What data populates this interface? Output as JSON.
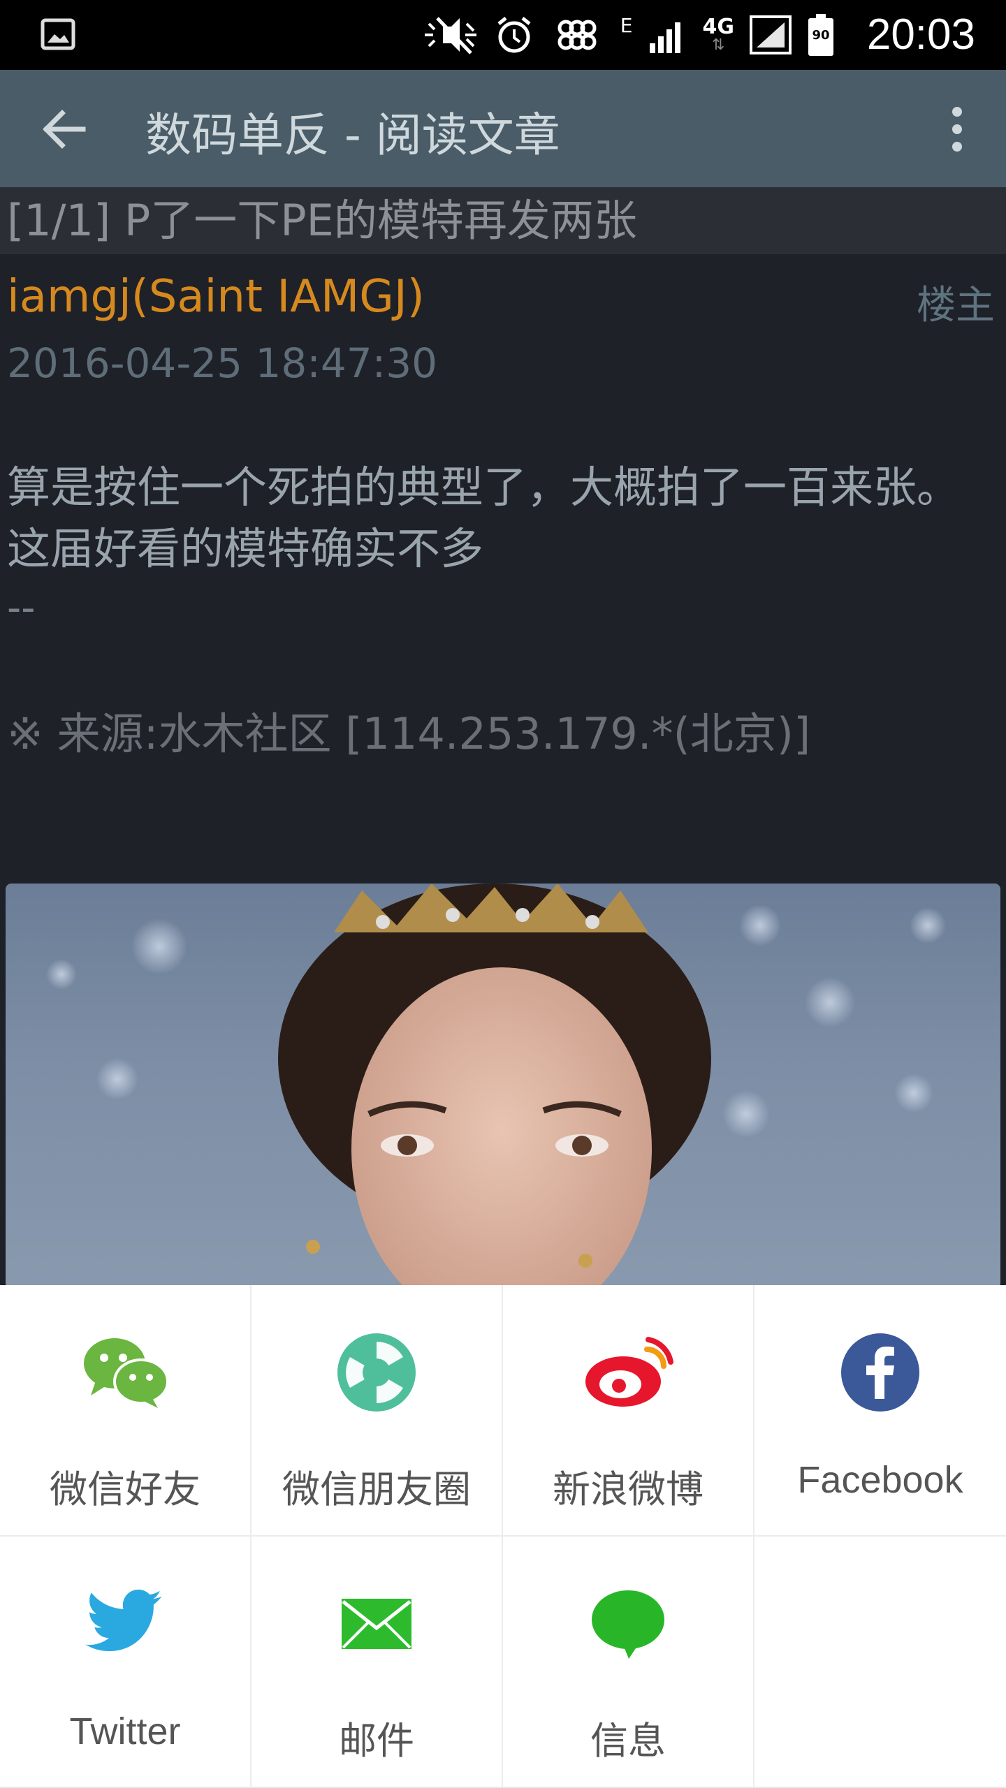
{
  "status_bar": {
    "time": "20:03",
    "battery": "90",
    "network_type": "4G",
    "edge_indicator": "E",
    "icons": [
      "gallery-icon",
      "mute-icon",
      "alarm-icon",
      "carrier-icon",
      "signal-icon",
      "battery-icon"
    ]
  },
  "app_bar": {
    "title": "数码单反 - 阅读文章"
  },
  "post": {
    "thread_title": "[1/1] P了一下PE的模特再发两张",
    "author": "iamgj(Saint IAMGJ)",
    "floor": "楼主",
    "time": "2016-04-25 18:47:30",
    "body": "算是按住一个死拍的典型了，大概拍了一百来张。这届好看的模特确实不多",
    "signature": "--",
    "source": "※ 来源:水木社区 [114.253.179.*(北京)]"
  },
  "share": {
    "items": [
      {
        "label": "微信好友",
        "icon": "wechat-icon",
        "color": "#6ab640"
      },
      {
        "label": "微信朋友圈",
        "icon": "wechat-moments-icon",
        "color": "#4fbf9b"
      },
      {
        "label": "新浪微博",
        "icon": "weibo-icon",
        "color": "#e6162d"
      },
      {
        "label": "Facebook",
        "icon": "facebook-icon",
        "color": "#3b5998"
      },
      {
        "label": "Twitter",
        "icon": "twitter-icon",
        "color": "#2aa9e0"
      },
      {
        "label": "邮件",
        "icon": "mail-icon",
        "color": "#2dbb2d"
      },
      {
        "label": "信息",
        "icon": "message-icon",
        "color": "#28b628"
      }
    ]
  }
}
